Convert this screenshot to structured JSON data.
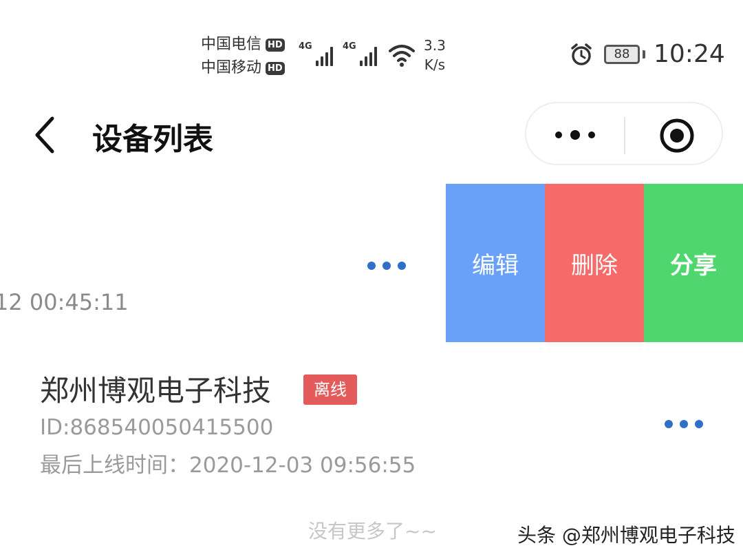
{
  "status_bar": {
    "carrier1": "中国电信",
    "carrier2": "中国移动",
    "hd_badge": "HD",
    "network1": "4G",
    "network2": "4G",
    "speed_value": "3.3",
    "speed_unit": "K/s",
    "battery": "88",
    "time": "10:24"
  },
  "nav": {
    "title": "设备列表"
  },
  "row1": {
    "last_online_partial": "12 00:45:11",
    "actions": {
      "edit": "编辑",
      "delete": "删除",
      "share": "分享"
    },
    "action_colors": {
      "edit": "#6aa1f8",
      "delete": "#f76a6a",
      "share": "#4fd66f"
    }
  },
  "row2": {
    "name": "郑州博观电子科技",
    "status": "离线",
    "id": "ID:868540050415500",
    "last_online": "最后上线时间：2020-12-03 09:56:55"
  },
  "footer": {
    "no_more": "没有更多了~~"
  },
  "watermark": "头条 @郑州博观电子科技",
  "colors": {
    "accent_dots": "#2f6ec9",
    "offline_badge": "#e45b5b"
  },
  "icons": {
    "back": "chevron-left-icon",
    "capsule_more": "more-dots-icon",
    "capsule_close": "record-circle-icon",
    "alarm": "alarm-clock-icon",
    "wifi": "wifi-icon"
  }
}
